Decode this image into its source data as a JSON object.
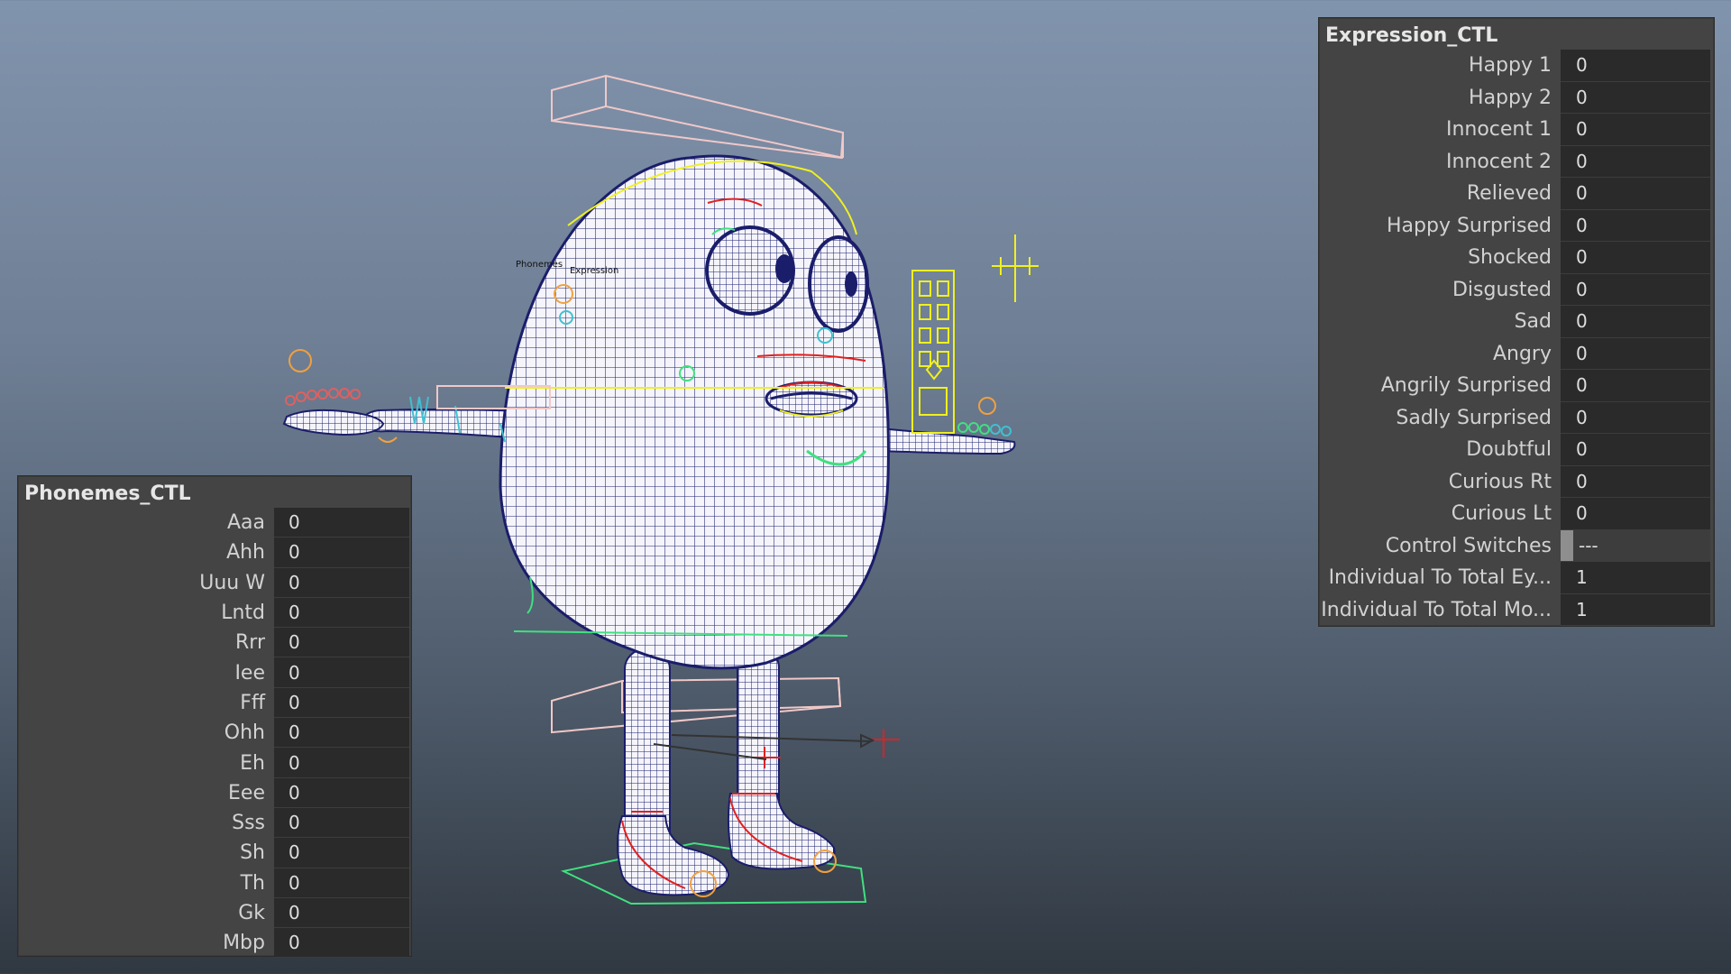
{
  "expression_panel": {
    "title": "Expression_CTL",
    "attributes": [
      {
        "label": "Happy 1",
        "value": "0"
      },
      {
        "label": "Happy 2",
        "value": "0"
      },
      {
        "label": "Innocent 1",
        "value": "0"
      },
      {
        "label": "Innocent 2",
        "value": "0"
      },
      {
        "label": "Relieved",
        "value": "0"
      },
      {
        "label": "Happy Surprised",
        "value": "0"
      },
      {
        "label": "Shocked",
        "value": "0"
      },
      {
        "label": "Disgusted",
        "value": "0"
      },
      {
        "label": "Sad",
        "value": "0"
      },
      {
        "label": "Angry",
        "value": "0"
      },
      {
        "label": "Angrily Surprised",
        "value": "0"
      },
      {
        "label": "Sadly Surprised",
        "value": "0"
      },
      {
        "label": "Doubtful",
        "value": "0"
      },
      {
        "label": "Curious Rt",
        "value": "0"
      },
      {
        "label": "Curious Lt",
        "value": "0"
      },
      {
        "label": "Control Switches",
        "value": "---"
      },
      {
        "label": "Individual To Total Ey...",
        "value": "1"
      },
      {
        "label": "Individual To Total Mo...",
        "value": "1"
      }
    ]
  },
  "phonemes_panel": {
    "title": "Phonemes_CTL",
    "attributes": [
      {
        "label": "Aaa",
        "value": "0"
      },
      {
        "label": "Ahh",
        "value": "0"
      },
      {
        "label": "Uuu W",
        "value": "0"
      },
      {
        "label": "Lntd",
        "value": "0"
      },
      {
        "label": "Rrr",
        "value": "0"
      },
      {
        "label": "Iee",
        "value": "0"
      },
      {
        "label": "Fff",
        "value": "0"
      },
      {
        "label": "Ohh",
        "value": "0"
      },
      {
        "label": "Eh",
        "value": "0"
      },
      {
        "label": "Eee",
        "value": "0"
      },
      {
        "label": "Sss",
        "value": "0"
      },
      {
        "label": "Sh",
        "value": "0"
      },
      {
        "label": "Th",
        "value": "0"
      },
      {
        "label": "Gk",
        "value": "0"
      },
      {
        "label": "Mbp",
        "value": "0"
      }
    ]
  },
  "viewport": {
    "head_labels": [
      "Phonemes",
      "Expression"
    ],
    "colors": {
      "mesh": "#f2f2f8",
      "wire": "#1a1d6a",
      "control_pink": "#f0c8c8",
      "control_yellow": "#f0f020",
      "control_green": "#40e080",
      "control_red": "#e02020",
      "control_cyan": "#40c0d0",
      "control_orange": "#f0a040"
    }
  }
}
